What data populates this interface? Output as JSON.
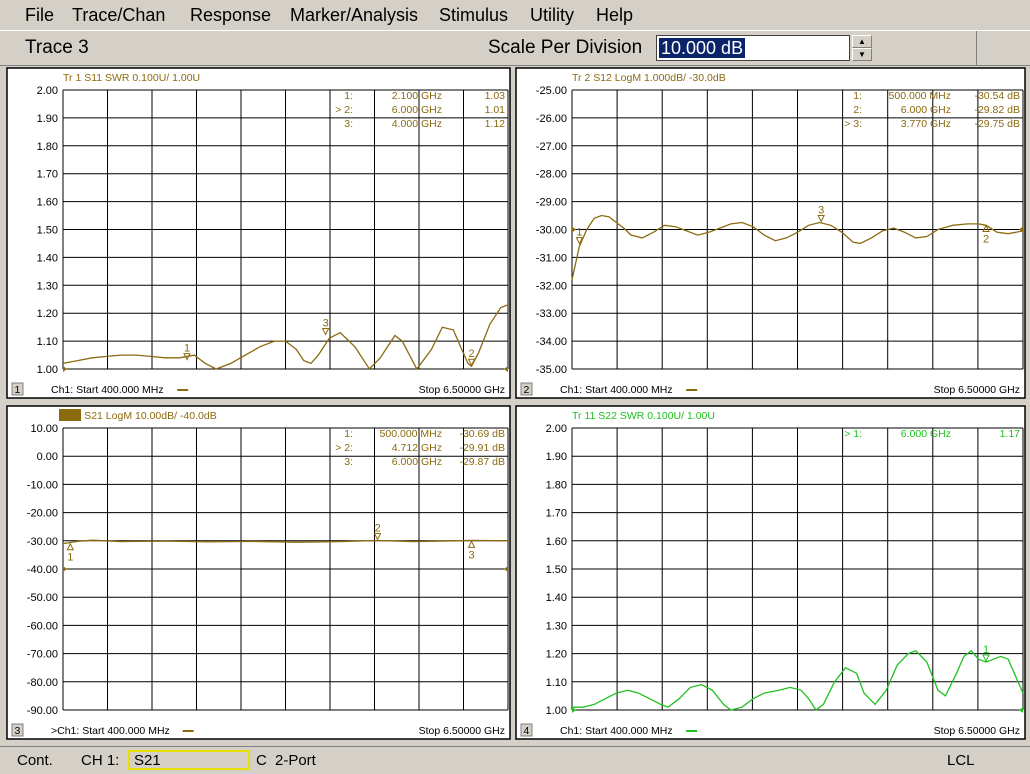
{
  "menu": [
    "File",
    "Trace/Chan",
    "Response",
    "Marker/Analysis",
    "Stimulus",
    "Utility",
    "Help"
  ],
  "toolbar": {
    "trace_label": "Trace 3",
    "scale_label": "Scale Per Division",
    "scale_value": "10.000 dB",
    "spin_up": "▲",
    "spin_down": "▼"
  },
  "status": {
    "mode": "Cont.",
    "channel": "CH 1:",
    "param": "S21",
    "cal": "C",
    "port": "2-Port",
    "lcl": "LCL"
  },
  "colors": {
    "trace_gold": "#8b6a10",
    "trace_green": "#20c020",
    "grid": "#000000",
    "background": "#ffffff"
  },
  "chart_data": [
    {
      "type": "line",
      "window_number": "1",
      "header": "Tr  1   S11 SWR 0.100U/  1.00U",
      "color": "#8b6a10",
      "y_ticks": [
        "2.00",
        "1.90",
        "1.80",
        "1.70",
        "1.60",
        "1.50",
        "1.40",
        "1.30",
        "1.20",
        "1.10",
        "1.00"
      ],
      "ylim": [
        1.0,
        2.0
      ],
      "xlim": [
        0.4,
        6.5
      ],
      "start_label": "Ch1: Start  400.000 MHz",
      "stop_label": "Stop  6.50000 GHz",
      "markers": [
        {
          "label": "1:",
          "freq": "2.100 GHz",
          "value": "1.03",
          "x": 2.1,
          "y": 1.03,
          "num": "1"
        },
        {
          "label": "> 2:",
          "freq": "6.000 GHz",
          "value": "1.01",
          "x": 6.0,
          "y": 1.01,
          "num": "2"
        },
        {
          "label": "3:",
          "freq": "4.000 GHz",
          "value": "1.12",
          "x": 4.0,
          "y": 1.12,
          "num": "3"
        }
      ],
      "trace": [
        [
          0.4,
          1.02
        ],
        [
          0.6,
          1.03
        ],
        [
          0.8,
          1.04
        ],
        [
          1.0,
          1.045
        ],
        [
          1.2,
          1.05
        ],
        [
          1.4,
          1.05
        ],
        [
          1.6,
          1.045
        ],
        [
          1.8,
          1.04
        ],
        [
          2.0,
          1.04
        ],
        [
          2.2,
          1.05
        ],
        [
          2.35,
          1.02
        ],
        [
          2.5,
          1.0
        ],
        [
          2.7,
          1.02
        ],
        [
          2.9,
          1.05
        ],
        [
          3.1,
          1.08
        ],
        [
          3.3,
          1.1
        ],
        [
          3.45,
          1.1
        ],
        [
          3.6,
          1.07
        ],
        [
          3.7,
          1.03
        ],
        [
          3.8,
          1.02
        ],
        [
          3.9,
          1.05
        ],
        [
          4.05,
          1.11
        ],
        [
          4.2,
          1.13
        ],
        [
          4.4,
          1.08
        ],
        [
          4.6,
          1.0
        ],
        [
          4.75,
          1.04
        ],
        [
          4.95,
          1.12
        ],
        [
          5.05,
          1.1
        ],
        [
          5.25,
          1.0
        ],
        [
          5.45,
          1.07
        ],
        [
          5.6,
          1.15
        ],
        [
          5.75,
          1.14
        ],
        [
          5.85,
          1.08
        ],
        [
          5.95,
          1.02
        ],
        [
          6.0,
          1.01
        ],
        [
          6.1,
          1.06
        ],
        [
          6.25,
          1.16
        ],
        [
          6.4,
          1.22
        ],
        [
          6.5,
          1.23
        ]
      ]
    },
    {
      "type": "line",
      "window_number": "2",
      "header": "Tr  2   S12 LogM 1.000dB/  -30.0dB",
      "color": "#8b6a10",
      "y_ticks": [
        "-25.00",
        "-26.00",
        "-27.00",
        "-28.00",
        "-29.00",
        "-30.00",
        "-31.00",
        "-32.00",
        "-33.00",
        "-34.00",
        "-35.00"
      ],
      "ylim": [
        -35,
        -25
      ],
      "xlim": [
        0.4,
        6.5
      ],
      "start_label": "Ch1: Start  400.000 MHz",
      "stop_label": "Stop  6.50000 GHz",
      "markers": [
        {
          "label": "1:",
          "freq": "500.000 MHz",
          "value": "-30.54 dB",
          "x": 0.5,
          "y": -30.54,
          "num": "1"
        },
        {
          "label": "2:",
          "freq": "6.000 GHz",
          "value": "-29.82 dB",
          "x": 6.0,
          "y": -29.82,
          "num": "2"
        },
        {
          "label": "> 3:",
          "freq": "3.770 GHz",
          "value": "-29.75 dB",
          "x": 3.77,
          "y": -29.75,
          "num": "3"
        }
      ],
      "trace": [
        [
          0.4,
          -31.8
        ],
        [
          0.45,
          -31.2
        ],
        [
          0.5,
          -30.6
        ],
        [
          0.6,
          -30.0
        ],
        [
          0.7,
          -29.6
        ],
        [
          0.8,
          -29.5
        ],
        [
          0.9,
          -29.55
        ],
        [
          1.0,
          -29.75
        ],
        [
          1.1,
          -29.95
        ],
        [
          1.2,
          -30.2
        ],
        [
          1.35,
          -30.3
        ],
        [
          1.5,
          -30.1
        ],
        [
          1.65,
          -29.85
        ],
        [
          1.8,
          -29.9
        ],
        [
          1.95,
          -30.05
        ],
        [
          2.1,
          -30.2
        ],
        [
          2.25,
          -30.1
        ],
        [
          2.4,
          -29.95
        ],
        [
          2.55,
          -29.8
        ],
        [
          2.7,
          -29.75
        ],
        [
          2.85,
          -29.9
        ],
        [
          3.0,
          -30.2
        ],
        [
          3.15,
          -30.4
        ],
        [
          3.3,
          -30.3
        ],
        [
          3.45,
          -30.1
        ],
        [
          3.6,
          -29.85
        ],
        [
          3.75,
          -29.75
        ],
        [
          3.9,
          -29.85
        ],
        [
          4.05,
          -30.1
        ],
        [
          4.2,
          -30.45
        ],
        [
          4.3,
          -30.5
        ],
        [
          4.45,
          -30.3
        ],
        [
          4.6,
          -30.05
        ],
        [
          4.75,
          -29.95
        ],
        [
          4.9,
          -30.1
        ],
        [
          5.05,
          -30.3
        ],
        [
          5.2,
          -30.25
        ],
        [
          5.35,
          -30.0
        ],
        [
          5.55,
          -29.85
        ],
        [
          5.75,
          -29.8
        ],
        [
          5.9,
          -29.8
        ],
        [
          6.0,
          -29.85
        ],
        [
          6.15,
          -30.1
        ],
        [
          6.3,
          -30.15
        ],
        [
          6.5,
          -30.05
        ]
      ]
    },
    {
      "type": "line",
      "window_number": "3",
      "header": "Tr  3   S21 LogM 10.00dB/  -40.0dB",
      "active": true,
      "color": "#8b6a10",
      "y_ticks": [
        "10.00",
        "0.00",
        "-10.00",
        "-20.00",
        "-30.00",
        "-40.00",
        "-50.00",
        "-60.00",
        "-70.00",
        "-80.00",
        "-90.00"
      ],
      "ylim": [
        -90,
        10
      ],
      "xlim": [
        0.4,
        6.5
      ],
      "start_label": ">Ch1: Start  400.000 MHz",
      "stop_label": "Stop  6.50000 GHz",
      "markers": [
        {
          "label": "1:",
          "freq": "500.000 MHz",
          "value": "-30.69 dB",
          "x": 0.5,
          "y": -30.69,
          "num": "1"
        },
        {
          "label": "> 2:",
          "freq": "4.712 GHz",
          "value": "-29.91 dB",
          "x": 4.712,
          "y": -29.91,
          "num": "2"
        },
        {
          "label": "3:",
          "freq": "6.000 GHz",
          "value": "-29.87 dB",
          "x": 6.0,
          "y": -29.87,
          "num": "3"
        }
      ],
      "trace": [
        [
          0.4,
          -31.0
        ],
        [
          0.6,
          -30.2
        ],
        [
          0.8,
          -29.8
        ],
        [
          1.2,
          -30.3
        ],
        [
          1.8,
          -30.1
        ],
        [
          2.4,
          -30.4
        ],
        [
          3.0,
          -30.2
        ],
        [
          3.6,
          -30.5
        ],
        [
          4.2,
          -30.3
        ],
        [
          4.712,
          -29.91
        ],
        [
          5.2,
          -30.3
        ],
        [
          5.8,
          -30.0
        ],
        [
          6.0,
          -29.87
        ],
        [
          6.5,
          -30.0
        ]
      ]
    },
    {
      "type": "line",
      "window_number": "4",
      "header": "Tr 11   S22 SWR 0.100U/  1.00U",
      "color": "#20c020",
      "y_ticks": [
        "2.00",
        "1.90",
        "1.80",
        "1.70",
        "1.60",
        "1.50",
        "1.40",
        "1.30",
        "1.20",
        "1.10",
        "1.00"
      ],
      "ylim": [
        1.0,
        2.0
      ],
      "xlim": [
        0.4,
        6.5
      ],
      "start_label": "Ch1: Start  400.000 MHz",
      "stop_label": "Stop  6.50000 GHz",
      "markers": [
        {
          "label": "> 1:",
          "freq": "6.000 GHz",
          "value": "1.17",
          "x": 6.0,
          "y": 1.17,
          "num": "1"
        }
      ],
      "trace": [
        [
          0.4,
          1.01
        ],
        [
          0.55,
          1.01
        ],
        [
          0.7,
          1.02
        ],
        [
          0.85,
          1.04
        ],
        [
          1.0,
          1.06
        ],
        [
          1.15,
          1.07
        ],
        [
          1.3,
          1.06
        ],
        [
          1.45,
          1.04
        ],
        [
          1.6,
          1.02
        ],
        [
          1.7,
          1.01
        ],
        [
          1.85,
          1.04
        ],
        [
          2.0,
          1.08
        ],
        [
          2.15,
          1.09
        ],
        [
          2.3,
          1.07
        ],
        [
          2.45,
          1.02
        ],
        [
          2.55,
          0.99
        ],
        [
          2.7,
          1.01
        ],
        [
          2.85,
          1.04
        ],
        [
          3.0,
          1.06
        ],
        [
          3.2,
          1.07
        ],
        [
          3.35,
          1.08
        ],
        [
          3.5,
          1.07
        ],
        [
          3.6,
          1.04
        ],
        [
          3.7,
          1.0
        ],
        [
          3.8,
          1.02
        ],
        [
          3.95,
          1.1
        ],
        [
          4.1,
          1.15
        ],
        [
          4.25,
          1.13
        ],
        [
          4.35,
          1.06
        ],
        [
          4.5,
          1.02
        ],
        [
          4.65,
          1.07
        ],
        [
          4.8,
          1.16
        ],
        [
          4.95,
          1.2
        ],
        [
          5.05,
          1.21
        ],
        [
          5.2,
          1.17
        ],
        [
          5.35,
          1.07
        ],
        [
          5.45,
          1.05
        ],
        [
          5.6,
          1.13
        ],
        [
          5.7,
          1.19
        ],
        [
          5.8,
          1.21
        ],
        [
          5.9,
          1.18
        ],
        [
          6.0,
          1.17
        ],
        [
          6.1,
          1.18
        ],
        [
          6.2,
          1.19
        ],
        [
          6.3,
          1.18
        ],
        [
          6.4,
          1.12
        ],
        [
          6.5,
          1.06
        ]
      ]
    }
  ]
}
